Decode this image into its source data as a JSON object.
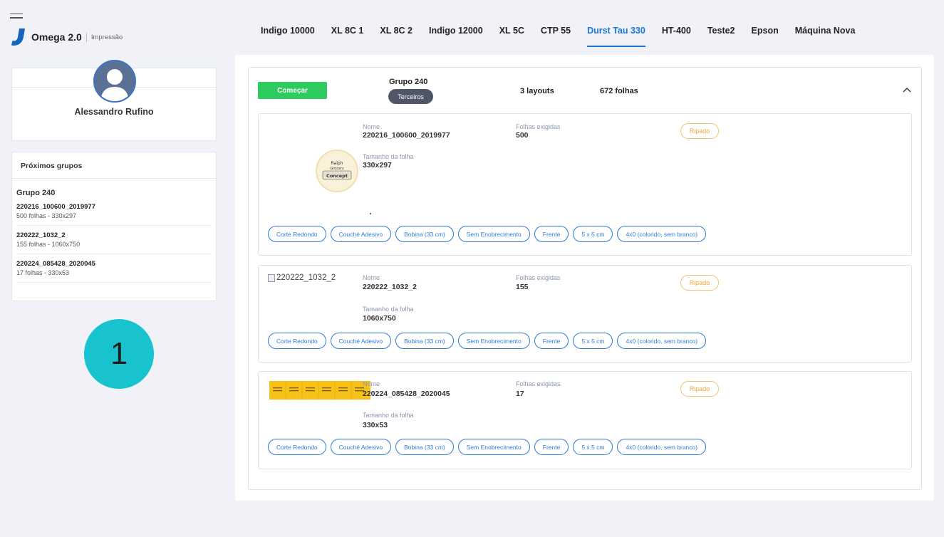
{
  "brand": {
    "name": "Omega 2.0",
    "sub": "Impressão"
  },
  "tabs": [
    "Indigo 10000",
    "XL 8C 1",
    "XL 8C 2",
    "Indigo 12000",
    "XL 5C",
    "CTP 55",
    "Durst Tau 330",
    "HT-400",
    "Teste2",
    "Epson",
    "Máquina Nova"
  ],
  "active_tab": "Durst Tau 330",
  "profile": {
    "name": "Alessandro Rufino"
  },
  "next_groups": {
    "header": "Próximos grupos",
    "group_title": "Grupo 240",
    "items": [
      {
        "name": "220216_100600_2019977",
        "desc": "500 folhas - 330x297"
      },
      {
        "name": "220222_1032_2",
        "desc": "155 folhas - 1060x750"
      },
      {
        "name": "220224_085428_2020045",
        "desc": "17 folhas - 330x53"
      }
    ]
  },
  "step_badge": "1",
  "group": {
    "start_label": "Começar",
    "title": "Grupo 240",
    "pill": "Terceiros",
    "layouts": "3 layouts",
    "sheets": "672 folhas"
  },
  "labels": {
    "name": "Nome",
    "sheets_required": "Folhas exigidas",
    "sheet_size": "Tamanho da folha",
    "status": "Ripado"
  },
  "layouts": [
    {
      "name": "220216_100600_2019977",
      "sheets": "500",
      "size": "330x297",
      "thumb_text": [
        "Ralph",
        "Grocers",
        "Concept"
      ],
      "tags": [
        "Corte Redondo",
        "Couché Adesivo",
        "Bobina (33 cm)",
        "Sem Enobrecimento",
        "Frente",
        "5 x 5 cm",
        "4x0 (colorido, sem branco)"
      ]
    },
    {
      "name": "220222_1032_2",
      "sheets": "155",
      "size": "1060x750",
      "broken_alt": "220222_1032_2",
      "tags": [
        "Corte Redondo",
        "Couché Adesivo",
        "Bobina (33 cm)",
        "Sem Enobrecimento",
        "Frente",
        "5 x 5 cm",
        "4x0 (colorido, sem branco)"
      ]
    },
    {
      "name": "220224_085428_2020045",
      "sheets": "17",
      "size": "330x53",
      "strip_text": "TESTE ADESIVO",
      "tags": [
        "Corte Redondo",
        "Couché Adesivo",
        "Bobina (33 cm)",
        "Sem Enobrecimento",
        "Frente",
        "5 x 5 cm",
        "4x0 (colorido, sem branco)"
      ]
    }
  ],
  "colors": {
    "primary": "#1976d2",
    "start": "#2ecc5e",
    "badge": "#18c3cd",
    "ripado": "#f0a63b",
    "tag": "#2f7bd4"
  }
}
